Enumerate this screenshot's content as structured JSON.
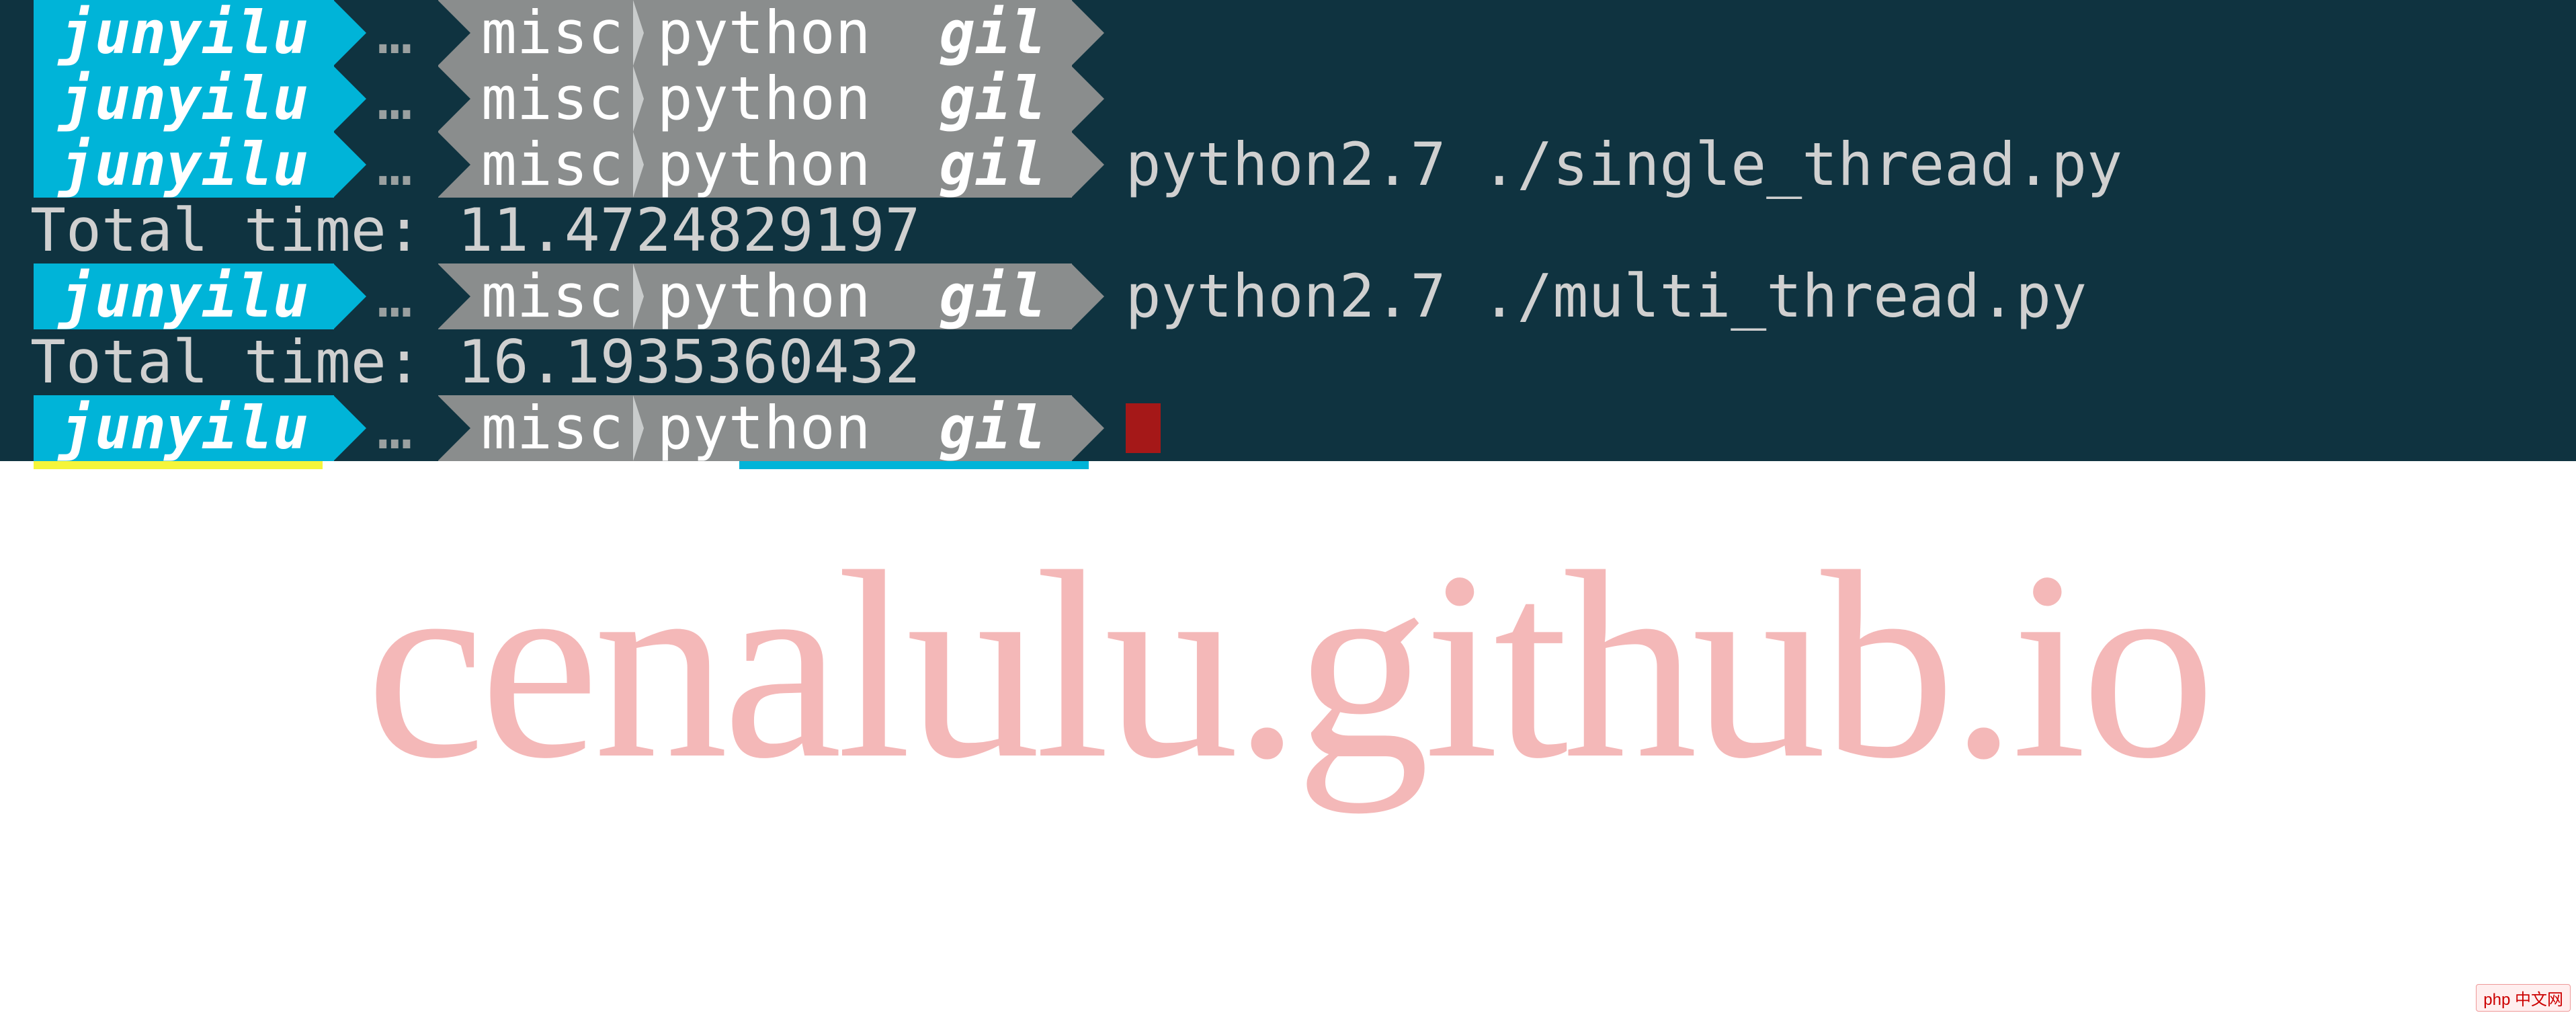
{
  "prompt": {
    "user": "junyilu",
    "dots": "…",
    "path_parts": [
      "misc",
      "python"
    ],
    "dir": "gil"
  },
  "lines": [
    {
      "type": "prompt",
      "cmd": ""
    },
    {
      "type": "prompt",
      "cmd": ""
    },
    {
      "type": "prompt",
      "cmd": "python2.7 ./single_thread.py"
    },
    {
      "type": "output",
      "text": "Total time: 11.4724829197"
    },
    {
      "type": "prompt",
      "cmd": "python2.7 ./multi_thread.py"
    },
    {
      "type": "output",
      "text": "Total time: 16.1935360432"
    },
    {
      "type": "prompt",
      "cmd": "",
      "cursor": true
    }
  ],
  "watermark": "cenalulu.github.io",
  "corner_badge": "php 中文网"
}
